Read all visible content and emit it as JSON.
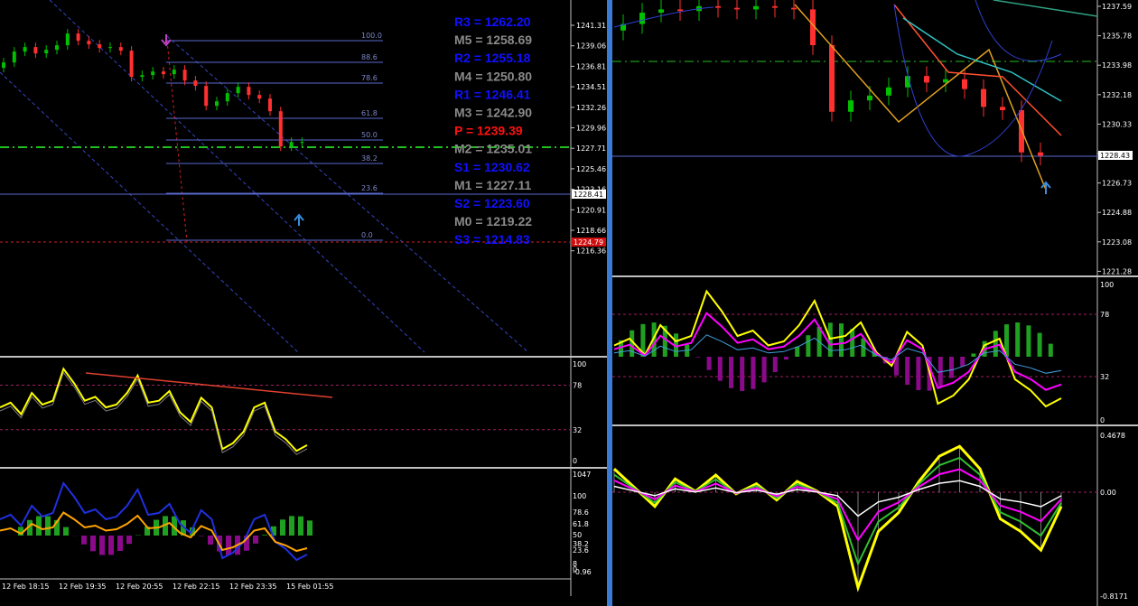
{
  "colors": {
    "background": "#000000",
    "window_border": "#3a7bd5",
    "panel_separator": "#c0c0c0",
    "bull_candle": "#00c000",
    "bear_candle": "#ff3030",
    "pivot_blue": "#1010ff",
    "pivot_gray": "#8a8a8a",
    "pivot_red": "#ff1010",
    "fib_line": "#5a6ad0",
    "channel_line": "#3545c0",
    "yellow_line": "#ffff00",
    "magenta_line": "#ff00ff",
    "green_bars": "#20a020",
    "purple_bars": "#8a0a8a",
    "support_red": "#d02020",
    "dashdot_green": "#20c020",
    "current_price_tag": "#ffffff",
    "red_price_tag": "#d01010"
  },
  "left_window": {
    "price_axis": [
      "1241.31",
      "1239.06",
      "1236.81",
      "1234.51",
      "1232.26",
      "1229.96",
      "1227.71",
      "1225.46",
      "1223.16",
      "1220.91",
      "1218.66",
      "1216.36"
    ],
    "current_price_tag": "1228.41",
    "red_price_tag": "1224.79",
    "fib_levels": [
      "100.0",
      "88.6",
      "78.6",
      "61.8",
      "50.0",
      "38.2",
      "23.6",
      "0.0"
    ],
    "pivots": [
      {
        "label": "R3 = 1262.20",
        "color": "blue"
      },
      {
        "label": "M5 = 1258.69",
        "color": "gray"
      },
      {
        "label": "R2 = 1255.18",
        "color": "blue"
      },
      {
        "label": "M4 = 1250.80",
        "color": "gray"
      },
      {
        "label": "R1 = 1246.41",
        "color": "blue"
      },
      {
        "label": "M3 = 1242.90",
        "color": "gray"
      },
      {
        "label": "P   = 1239.39",
        "color": "red"
      },
      {
        "label": "M2 = 1235.01",
        "color": "gray"
      },
      {
        "label": "S1 = 1230.62",
        "color": "blue"
      },
      {
        "label": "M1 = 1227.11",
        "color": "gray"
      },
      {
        "label": "S2 = 1223.60",
        "color": "blue"
      },
      {
        "label": "M0 = 1219.22",
        "color": "gray"
      },
      {
        "label": "S3 = 1214.83",
        "color": "blue"
      }
    ],
    "osc1_axis": [
      "100",
      "78",
      "32",
      "0"
    ],
    "osc2_axis": [
      "1047",
      "100",
      "78.6",
      "61.8",
      "50",
      "38.2",
      "23.6",
      "8",
      "0",
      "-0.96"
    ],
    "time_axis": [
      "12 Feb 18:15",
      "12 Feb 19:35",
      "12 Feb 20:55",
      "12 Feb 22:15",
      "12 Feb 23:35",
      "15 Feb 01:55"
    ]
  },
  "right_window": {
    "price_axis": [
      "1237.59",
      "1235.78",
      "1233.98",
      "1232.18",
      "1230.33",
      "1228.43",
      "1226.73",
      "1224.88",
      "1223.08",
      "1221.28"
    ],
    "current_price_tag": "1228.43",
    "osc1_axis": [
      "100",
      "78",
      "32",
      "0"
    ],
    "osc2_axis": [
      "0.4678",
      "0.00",
      "-0.8171"
    ]
  },
  "chart_data": [
    {
      "type": "line",
      "title": "",
      "series": [
        {
          "name": "",
          "values": [
            1237.2,
            1238.4,
            1238.9,
            1238.2,
            1238.6,
            1239.1,
            1240.4,
            1239.6,
            1239.2,
            1238.8,
            1238.9,
            1238.5,
            1235.6,
            1235.8,
            1236.2,
            1235.9,
            1236.4,
            1235.2,
            1234.6,
            1232.4,
            1232.9,
            1233.8,
            1234.5,
            1233.6,
            1233.2,
            1231.8,
            1227.9,
            1228.4,
            1228.4
          ]
        }
      ],
      "ylim": [
        1216.36,
        1241.31
      ],
      "xlabel": "",
      "ylabel": ""
    },
    {
      "type": "line",
      "series": [
        {
          "name": "",
          "values": [
            55,
            60,
            48,
            70,
            58,
            62,
            95,
            80,
            62,
            66,
            55,
            58,
            70,
            88,
            60,
            62,
            72,
            50,
            40,
            65,
            55,
            12,
            18,
            30,
            55,
            60,
            30,
            22,
            10,
            16
          ]
        }
      ],
      "ylim": [
        0,
        100
      ]
    },
    {
      "type": "line",
      "series": [
        {
          "name": "",
          "values": [
            1236.5,
            1237.2,
            1237.4,
            1237.3,
            1237.6,
            1237.5,
            1237.4,
            1237.6,
            1237.5,
            1237.4,
            1235.2,
            1231.1,
            1231.8,
            1232.1,
            1232.6,
            1233.3,
            1232.9,
            1233.1,
            1232.5,
            1231.4,
            1231.2,
            1228.6,
            1228.4
          ]
        }
      ],
      "ylim": [
        1221.28,
        1237.59
      ]
    },
    {
      "type": "line",
      "series": [
        {
          "name": "",
          "values": [
            0.2,
            0.05,
            -0.1,
            0.12,
            0.02,
            0.15,
            0.0,
            0.08,
            -0.05,
            0.1,
            0.02,
            -0.1,
            -0.75,
            -0.3,
            -0.15,
            0.1,
            0.3,
            0.38,
            0.2,
            -0.2,
            -0.3,
            -0.45,
            -0.1
          ]
        }
      ],
      "ylim": [
        -0.8171,
        0.4678
      ]
    }
  ]
}
